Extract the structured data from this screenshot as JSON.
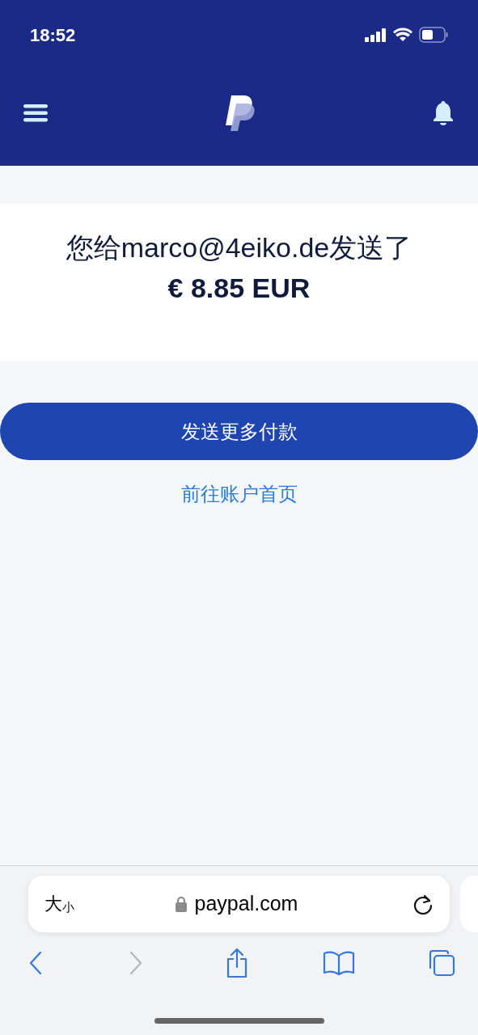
{
  "status_bar": {
    "time": "18:52"
  },
  "confirmation": {
    "message": "您给marco@4eiko.de发送了",
    "amount": "€ 8.85 EUR"
  },
  "primary_button": "发送更多付款",
  "secondary_link": "前往账户首页",
  "browser": {
    "text_size": {
      "large": "大",
      "small": "小"
    },
    "url": "paypal.com",
    "toolbar": [
      {
        "kind": "back",
        "disabled": false
      },
      {
        "kind": "forward",
        "disabled": true
      },
      {
        "kind": "share",
        "disabled": false
      },
      {
        "kind": "bookmarks",
        "disabled": false
      },
      {
        "kind": "tabs",
        "disabled": false
      }
    ]
  }
}
